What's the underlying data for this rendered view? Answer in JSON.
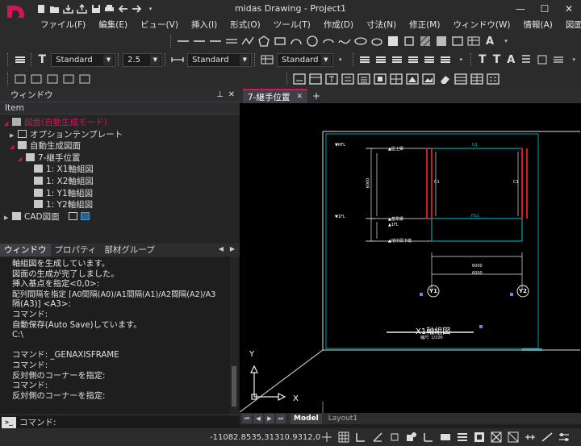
{
  "app": {
    "title": "midas Drawing - Project1",
    "brand_color": "#d4145a"
  },
  "window_controls": {
    "minimize": "—",
    "maximize": "☐",
    "close": "✕"
  },
  "menu": {
    "items": [
      {
        "label": "ファイル(F)"
      },
      {
        "label": "編集(E)"
      },
      {
        "label": "ビュー(V)"
      },
      {
        "label": "挿入(I)"
      },
      {
        "label": "形式(O)"
      },
      {
        "label": "ツール(T)"
      },
      {
        "label": "作成(D)"
      },
      {
        "label": "寸法(N)"
      },
      {
        "label": "修正(M)"
      },
      {
        "label": "ウィンドウ(W)"
      },
      {
        "label": "情報(A)"
      },
      {
        "label": "図面生成"
      }
    ]
  },
  "toolbar2": {
    "text_style": "Standard",
    "text_height": "2.5",
    "dim_style": "Standard",
    "table_style": "Standard"
  },
  "left_panel": {
    "header": "ウィンドウ",
    "pin_icon": "⊥",
    "close_icon": "✕",
    "column_header": "Item",
    "tree": {
      "root": "図面(自動生成モード)",
      "option_template": "オプションテンプレート",
      "auto_group": "自動生成図面",
      "joint_position": "7-継手位置",
      "children": [
        "1: X1軸組図",
        "1: X2軸組図",
        "1: Y1軸組図",
        "1: Y2軸組図"
      ],
      "cad": "CAD図面"
    },
    "tabs": [
      {
        "label": "ウィンドウ",
        "active": true
      },
      {
        "label": "プロパティ",
        "active": false
      },
      {
        "label": "部材グループ",
        "active": false
      }
    ],
    "console": {
      "lines": [
        "軸組図を生成しています。",
        "図面の生成が完了しました。",
        "挿入基点を指定<0,0>:",
        "配列間隔を指定 [A0間隔(A0)/A1間隔(A1)/A2間隔(A2)/A3",
        "隔(A3)] <A3>:",
        "コマンド:",
        "自動保存(Auto Save)しています。",
        "C:\\",
        "",
        "コマンド: _GENAXISFRAME",
        "コマンド:",
        "反対側のコーナーを指定:",
        "コマンド:",
        "反対側のコーナーを指定:"
      ],
      "prompt_label": "コマンド:"
    }
  },
  "doc_tab": {
    "label": "7-継手位置",
    "close": "✕",
    "add": "+"
  },
  "drawing": {
    "title": "X1軸組図",
    "scale_text": "縮尺: 1/100",
    "axis_left": "Y1",
    "axis_right": "Y2",
    "level_labels": [
      "▲屋上梁",
      "▲基準梁",
      "▲1FL",
      "▲地中梁下端"
    ],
    "dim_labels": [
      "6000",
      "6000",
      "6000"
    ],
    "left_marks": [
      "▼RFL",
      "▼1FL"
    ],
    "span_labels": [
      "G1",
      "FG1"
    ],
    "side_labels": [
      "C1",
      "C1"
    ],
    "ucs_x": "X",
    "ucs_y": "Y",
    "cyan_color": "#00c8d0",
    "red_color": "#cc2020"
  },
  "sheet_tabs": [
    {
      "label": "Model",
      "active": true
    },
    {
      "label": "Layout1",
      "active": false
    }
  ],
  "status": {
    "coordinates": "-11082.8535,31310.9312,0"
  }
}
